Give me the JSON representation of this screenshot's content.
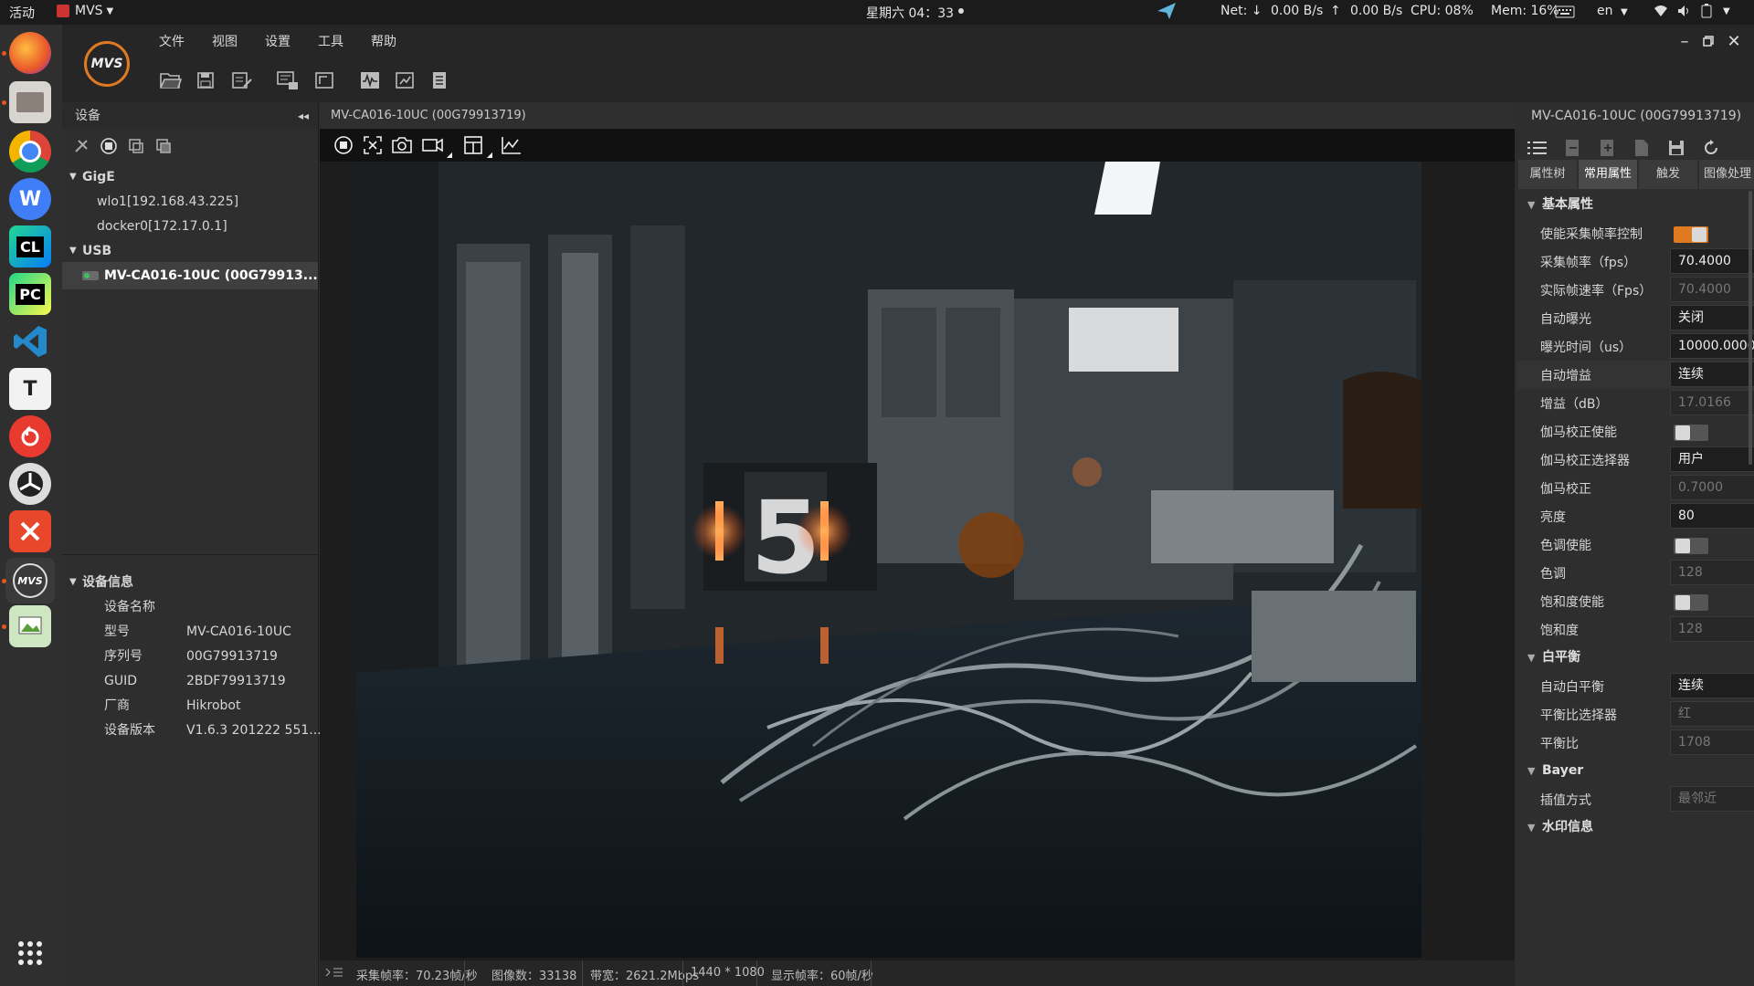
{
  "topbar": {
    "activities": "活动",
    "app_name": "MVS",
    "clock": "星期六 04：33",
    "net_label": "Net: ↓",
    "net_down": "0.00 B/s",
    "net_up_arrow": "↑",
    "net_up": "0.00 B/s",
    "cpu": "CPU: 08%",
    "mem": "Mem: 16%",
    "lang": "en"
  },
  "dock": {
    "items": [
      "firefox",
      "files",
      "chrome",
      "wps",
      "clion",
      "pycharm",
      "vscode",
      "typora",
      "netease-music",
      "app",
      "xmind",
      "mvs",
      "image-viewer",
      "show-apps"
    ]
  },
  "menubar": {
    "items": [
      "文件",
      "视图",
      "设置",
      "工具",
      "帮助"
    ]
  },
  "left_panel": {
    "title": "设备",
    "gige_label": "GigE",
    "gige_items": [
      "wlo1[192.168.43.225]",
      "docker0[172.17.0.1]"
    ],
    "usb_label": "USB",
    "usb_items": [
      "MV-CA016-10UC (00G79913..."
    ],
    "info_title": "设备信息",
    "info_rows": [
      {
        "key": "设备名称",
        "value": ""
      },
      {
        "key": "型号",
        "value": "MV-CA016-10UC"
      },
      {
        "key": "序列号",
        "value": "00G79913719"
      },
      {
        "key": "GUID",
        "value": "2BDF79913719"
      },
      {
        "key": "厂商",
        "value": "Hikrobot"
      },
      {
        "key": "设备版本",
        "value": "V1.6.3 201222 551..."
      }
    ]
  },
  "center": {
    "title": "MV-CA016-10UC (00G79913719)",
    "scene_digit": "5",
    "status": {
      "fps": "采集帧率：70.23帧/秒",
      "images": "图像数：33138",
      "bandwidth": "带宽：2621.2Mbps",
      "resolution": "1440 * 1080",
      "display_fps": "显示帧率：60帧/秒"
    }
  },
  "right_panel": {
    "title": "MV-CA016-10UC (00G79913719)",
    "tabs": [
      "属性树",
      "常用属性",
      "触发",
      "图像处理"
    ],
    "active_tab": "常用属性",
    "sections": {
      "basic": "基本属性",
      "wb": "白平衡",
      "bayer": "Bayer",
      "watermark": "水印信息"
    },
    "props": [
      {
        "label": "使能采集帧率控制",
        "value": "",
        "kind": "toggle",
        "on": true
      },
      {
        "label": "采集帧率（fps）",
        "value": "70.4000",
        "kind": "text"
      },
      {
        "label": "实际帧速率（Fps）",
        "value": "70.4000",
        "kind": "disabled"
      },
      {
        "label": "自动曝光",
        "value": "关闭",
        "kind": "dropdown"
      },
      {
        "label": "曝光时间（us）",
        "value": "10000.0000",
        "kind": "text"
      },
      {
        "label": "自动增益",
        "value": "连续",
        "kind": "dropdown"
      },
      {
        "label": "增益（dB）",
        "value": "17.0166",
        "kind": "disabled"
      },
      {
        "label": "伽马校正使能",
        "value": "",
        "kind": "toggle",
        "on": false
      },
      {
        "label": "伽马校正选择器",
        "value": "用户",
        "kind": "dropdown"
      },
      {
        "label": "伽马校正",
        "value": "0.7000",
        "kind": "disabled"
      },
      {
        "label": "亮度",
        "value": "80",
        "kind": "spin"
      },
      {
        "label": "色调使能",
        "value": "",
        "kind": "toggle",
        "on": false
      },
      {
        "label": "色调",
        "value": "128",
        "kind": "spin-disabled"
      },
      {
        "label": "饱和度使能",
        "value": "",
        "kind": "toggle",
        "on": false
      },
      {
        "label": "饱和度",
        "value": "128",
        "kind": "spin-disabled"
      },
      {
        "label": "自动白平衡",
        "value": "连续",
        "kind": "dropdown"
      },
      {
        "label": "平衡比选择器",
        "value": "红",
        "kind": "dropdown-disabled"
      },
      {
        "label": "平衡比",
        "value": "1708",
        "kind": "spin-disabled"
      },
      {
        "label": "插值方式",
        "value": "最邻近",
        "kind": "dropdown-disabled"
      }
    ]
  }
}
